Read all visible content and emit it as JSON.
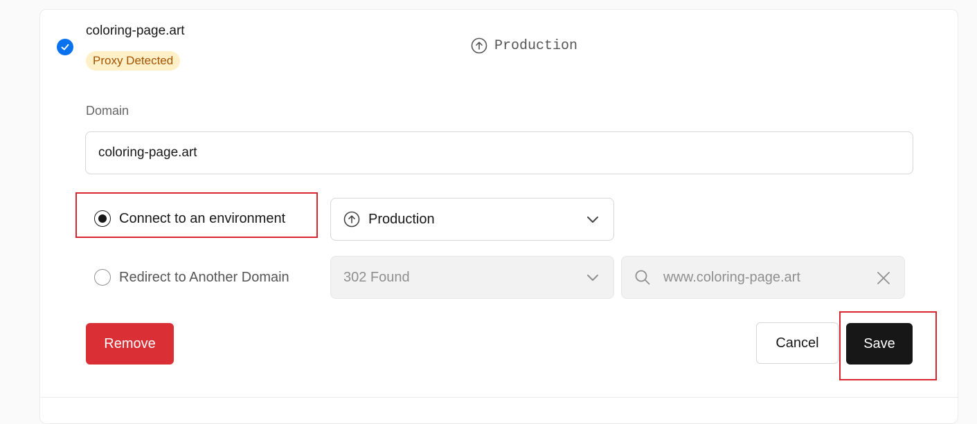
{
  "domain_entry": {
    "title": "coloring-page.art",
    "badge": "Proxy Detected",
    "environment": "Production"
  },
  "domain_field": {
    "label": "Domain",
    "value": "coloring-page.art"
  },
  "options": {
    "connect_label": "Connect to an environment",
    "connect_selected": true,
    "environment_select_value": "Production",
    "redirect_label": "Redirect to Another Domain",
    "redirect_selected": false,
    "status_code_select_value": "302 Found",
    "redirect_target_placeholder": "www.coloring-page.art"
  },
  "actions": {
    "remove_label": "Remove",
    "cancel_label": "Cancel",
    "save_label": "Save"
  },
  "colors": {
    "accent_blue": "#0a72ef",
    "danger_red": "#da2f35",
    "badge_bg": "#fff0c7",
    "badge_text": "#a35200",
    "highlight_red": "#d9232d"
  }
}
